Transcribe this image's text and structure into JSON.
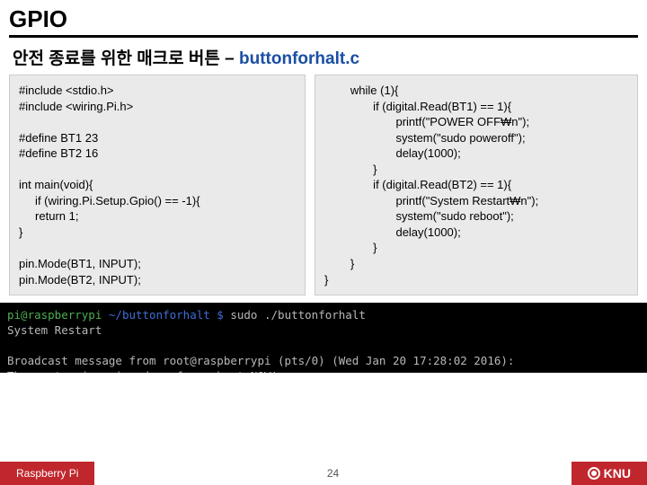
{
  "title": "GPIO",
  "subtitle_ko": "안전 종료를 위한 매크로 버튼 – ",
  "subtitle_file": "buttonforhalt.c",
  "code_left": "#include <stdio.h>\n#include <wiring.Pi.h>\n\n#define BT1 23\n#define BT2 16\n\nint main(void){\n     if (wiring.Pi.Setup.Gpio() == -1){\n     return 1;\n}\n\npin.Mode(BT1, INPUT);\npin.Mode(BT2, INPUT);",
  "code_right": "        while (1){\n               if (digital.Read(BT1) == 1){\n                      printf(\"POWER OFF₩n\");\n                      system(\"sudo poweroff\");\n                      delay(1000);\n               }\n               if (digital.Read(BT2) == 1){\n                      printf(\"System Restart₩n\");\n                      system(\"sudo reboot\");\n                      delay(1000);\n               }\n        }\n}",
  "terminal_prompt_user": "pi@raspberrypi ",
  "terminal_prompt_path": "~/buttonforhalt $ ",
  "terminal_cmd": "sudo ./buttonforhalt",
  "terminal_body": "System Restart\n\nBroadcast message from root@raspberrypi (pts/0) (Wed Jan 20 17:28:02 2016):\nThe system is going down for reboot NOW!",
  "footer_left": "Raspberry Pi",
  "page_number": "24",
  "footer_right": "KNU"
}
